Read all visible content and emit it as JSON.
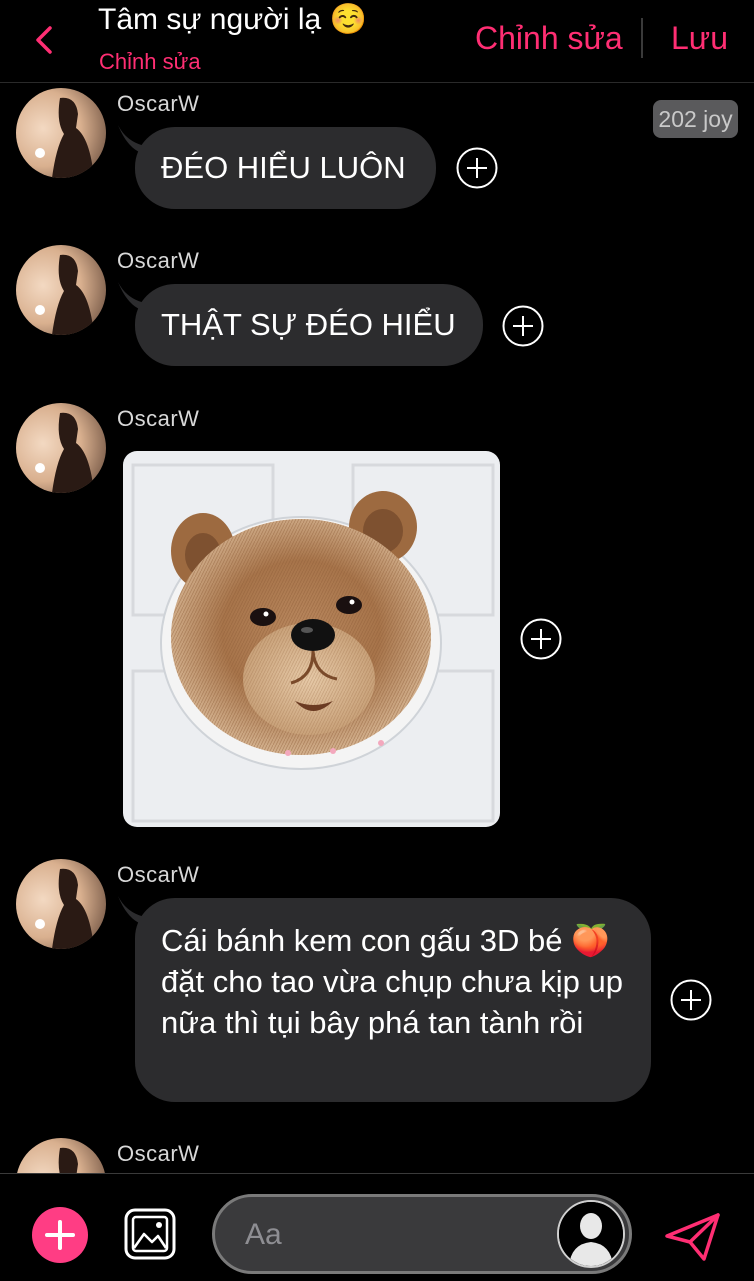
{
  "header": {
    "title": "Tâm sự người lạ ☺️",
    "subtitle": "Chỉnh sửa",
    "edit_label": "Chỉnh sửa",
    "save_label": "Lưu"
  },
  "messages": [
    {
      "sender": "OscarW",
      "type": "text",
      "text": "ĐÉO HIỂU LUÔN"
    },
    {
      "sender": "OscarW",
      "type": "text",
      "text": "THẬT SỰ ĐÉO HIỂU"
    },
    {
      "sender": "OscarW",
      "type": "image"
    },
    {
      "sender": "OscarW",
      "type": "text",
      "text": "Cái bánh kem con gấu 3D bé 🍑 đặt cho tao vừa chụp chưa kịp up nữa thì tụi bây phá tan tành rồi"
    },
    {
      "sender": "OscarW",
      "type": "text"
    }
  ],
  "badge": "202 joy",
  "composer": {
    "placeholder": "Aa"
  },
  "colors": {
    "accent": "#ff2e73",
    "bubble": "#2c2c2e",
    "background": "#000000"
  },
  "icons": {
    "back": "chevron-left-icon",
    "react": "plus-circle-icon",
    "add": "plus-icon",
    "image": "image-icon",
    "avatar": "user-silhouette-icon",
    "send": "send-icon"
  }
}
